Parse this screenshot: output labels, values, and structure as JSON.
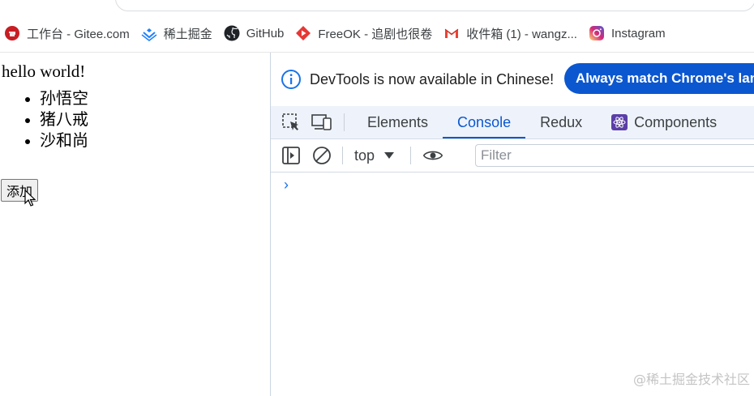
{
  "bookmarks": [
    {
      "label": "工作台 - Gitee.com",
      "icon": "gitee-icon"
    },
    {
      "label": "稀土掘金",
      "icon": "juejin-icon"
    },
    {
      "label": "GitHub",
      "icon": "github-icon"
    },
    {
      "label": "FreeOK - 追剧也很卷",
      "icon": "freeok-icon"
    },
    {
      "label": "收件箱 (1) - wangz...",
      "icon": "gmail-icon"
    },
    {
      "label": "Instagram",
      "icon": "instagram-icon"
    }
  ],
  "page": {
    "heading": "hello world!",
    "list": [
      "孙悟空",
      "猪八戒",
      "沙和尚"
    ],
    "add_button": "添加"
  },
  "devtools": {
    "infobar": {
      "message": "DevTools is now available in Chinese!",
      "match_button": "Always match Chrome's lan"
    },
    "tabs": [
      "Elements",
      "Console",
      "Redux",
      "Components"
    ],
    "active_tab": "Console",
    "toolbar": {
      "context": "top",
      "filter_placeholder": "Filter"
    },
    "prompt_symbol": "›"
  },
  "watermark": "@稀土掘金技术社区",
  "colors": {
    "accent": "#0b57d0",
    "tabbar_bg": "#eef3fb"
  }
}
